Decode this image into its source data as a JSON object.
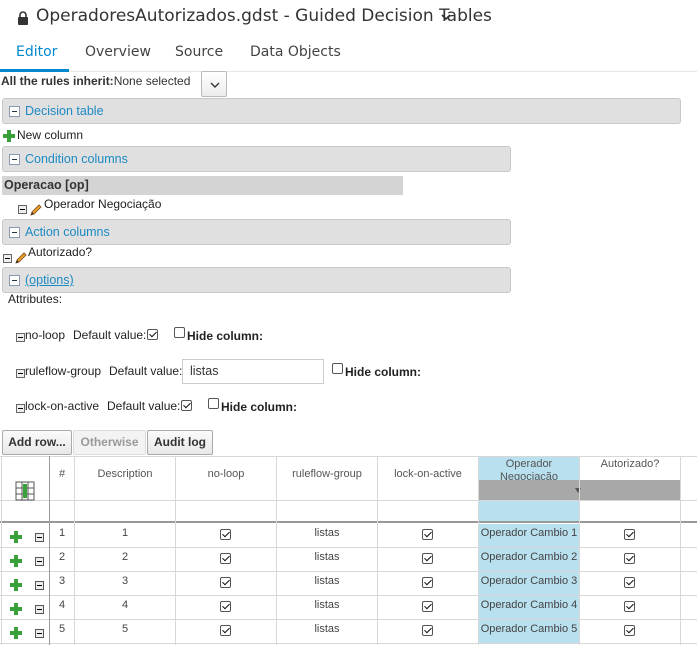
{
  "window": {
    "title": "OperadoresAutorizados.gdst - Guided Decision Tables"
  },
  "tabs": [
    {
      "label": "Editor",
      "active": true
    },
    {
      "label": "Overview",
      "active": false
    },
    {
      "label": "Source",
      "active": false
    },
    {
      "label": "Data Objects",
      "active": false
    }
  ],
  "inherit": {
    "label": "All the rules inherit:",
    "value": "None selected"
  },
  "sections": {
    "decision_table": "Decision table",
    "new_column": "New column",
    "condition_columns": "Condition columns",
    "condition_pattern": "Operacao [op]",
    "condition_item": "Operador Negociação",
    "action_columns": "Action columns",
    "action_item": "Autorizado?",
    "options": "(options)"
  },
  "attributes": {
    "label": "Attributes:",
    "default_value_label": "Default value:",
    "hide_column_label": "Hide column:",
    "items": [
      {
        "name": "no-loop",
        "default_checked": true,
        "hide": false
      },
      {
        "name": "ruleflow-group",
        "default_text": "listas",
        "hide": false
      },
      {
        "name": "lock-on-active",
        "default_checked": true,
        "hide": false
      }
    ]
  },
  "toolbar": {
    "add_row": "Add row...",
    "otherwise": "Otherwise",
    "audit_log": "Audit log"
  },
  "table": {
    "headers": [
      "#",
      "Description",
      "no-loop",
      "ruleflow-group",
      "lock-on-active",
      "Operador Negociação",
      "Autorizado?"
    ],
    "rows": [
      {
        "num": "1",
        "description": "1",
        "noloop": true,
        "group": "listas",
        "lock": true,
        "operador": "Operador Cambio 1",
        "autorizado": true
      },
      {
        "num": "2",
        "description": "2",
        "noloop": true,
        "group": "listas",
        "lock": true,
        "operador": "Operador Cambio 2",
        "autorizado": true
      },
      {
        "num": "3",
        "description": "3",
        "noloop": true,
        "group": "listas",
        "lock": true,
        "operador": "Operador Cambio 3",
        "autorizado": true
      },
      {
        "num": "4",
        "description": "4",
        "noloop": true,
        "group": "listas",
        "lock": true,
        "operador": "Operador Cambio 4",
        "autorizado": true
      },
      {
        "num": "5",
        "description": "5",
        "noloop": true,
        "group": "listas",
        "lock": true,
        "operador": "Operador Cambio 5",
        "autorizado": true
      }
    ]
  },
  "colors": {
    "accent": "#0088ce",
    "highlight_column": "#b9e0ee",
    "add_green": "#3aa13a"
  }
}
